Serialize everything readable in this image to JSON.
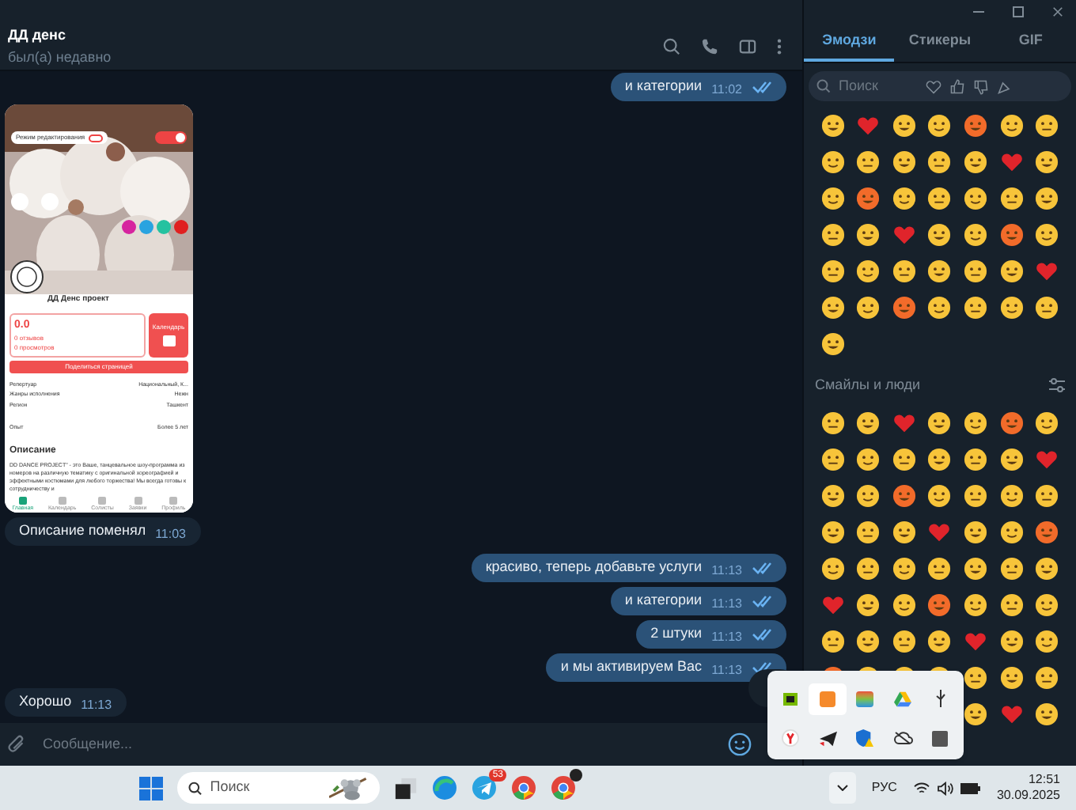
{
  "chat_header": {
    "title": "ДД денс",
    "status": "был(а) недавно"
  },
  "messages": [
    {
      "kind": "out",
      "text": "и категории",
      "time": "11:02",
      "read": true
    },
    {
      "kind": "app_screenshot",
      "edit_mode": {
        "label": "Режим редактирования",
        "on": false
      },
      "header_toggle": {
        "on": true
      },
      "name": "ДД Денс проект",
      "rating": "0.0",
      "reviews": "0 отзывов",
      "views": "0 просмотров",
      "calendar": "Календарь",
      "share": "Поделиться страницей",
      "details": [
        {
          "label": "Репертуар",
          "value": "Национальный, К..."
        },
        {
          "label": "Жанры исполнения",
          "value": "Нежн"
        },
        {
          "label": "Регион",
          "value": "Ташкент"
        },
        {
          "label": "Опыт",
          "value": "Более 5 лет"
        }
      ],
      "description_title": "Описание",
      "description": "DD DANCE PROJECT\" - это Ваше, танцевальное шоу-программа из номеров на различную тематику с оригинальной хореографией и эффектными костюмами для любого торжества! Мы всегда готовы к сотрудничеству и",
      "nav": [
        {
          "label": "Главная",
          "selected": true
        },
        {
          "label": "Календарь",
          "selected": false
        },
        {
          "label": "Солисты",
          "selected": false
        },
        {
          "label": "Заявки",
          "selected": false
        },
        {
          "label": "Профиль",
          "selected": false
        }
      ]
    },
    {
      "kind": "in",
      "text": "Описание поменял",
      "time": "11:03"
    },
    {
      "kind": "out",
      "text": "красиво, теперь добавьте услуги",
      "time": "11:13",
      "read": true
    },
    {
      "kind": "out",
      "text": "и категории",
      "time": "11:13",
      "read": true
    },
    {
      "kind": "out",
      "text": "2 штуки",
      "time": "11:13",
      "read": true
    },
    {
      "kind": "out",
      "text": "и мы активируем Вас",
      "time": "11:13",
      "read": true
    },
    {
      "kind": "in",
      "text": "Хорошо",
      "time": "11:13"
    }
  ],
  "composer": {
    "placeholder": "Сообщение..."
  },
  "emoji_panel": {
    "tabs": [
      {
        "label": "Эмодзи",
        "selected": true
      },
      {
        "label": "Стикеры",
        "selected": false
      },
      {
        "label": "GIF",
        "selected": false
      }
    ],
    "search": {
      "placeholder": "Поиск"
    },
    "section_title": "Смайлы и люди"
  },
  "taskbar": {
    "search": {
      "placeholder": "Поиск"
    },
    "telegram_badge": "53",
    "language": "РУС",
    "time": "12:51",
    "date": "30.09.2025"
  }
}
